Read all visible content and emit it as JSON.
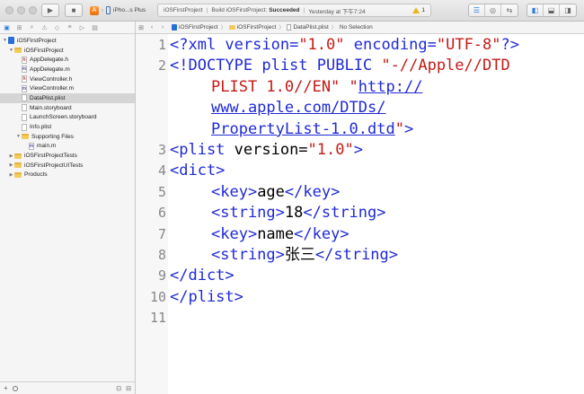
{
  "toolbar": {
    "scheme_device": "iPho...s Plus",
    "activity": {
      "project": "iOSFirstProject",
      "status_prefix": "Build iOSFirstProject:",
      "status_result": "Succeeded",
      "time": "Yesterday at 下午7:24",
      "warning_count": "1"
    }
  },
  "navigator": {
    "items": [
      {
        "label": "iOSFirstProject",
        "type": "project",
        "level": 0,
        "disclosure": "▼"
      },
      {
        "label": "iOSFirstProject",
        "type": "folder",
        "level": 1,
        "disclosure": "▼"
      },
      {
        "label": "AppDelegate.h",
        "type": "h",
        "level": 2
      },
      {
        "label": "AppDelegate.m",
        "type": "m",
        "level": 2
      },
      {
        "label": "ViewController.h",
        "type": "h",
        "level": 2
      },
      {
        "label": "ViewController.m",
        "type": "m",
        "level": 2
      },
      {
        "label": "DataPlist.plist",
        "type": "plist",
        "level": 2,
        "selected": true
      },
      {
        "label": "Main.storyboard",
        "type": "sb",
        "level": 2
      },
      {
        "label": "LaunchScreen.storyboard",
        "type": "sb",
        "level": 2
      },
      {
        "label": "Info.plist",
        "type": "plist",
        "level": 2
      },
      {
        "label": "Supporting Files",
        "type": "folder",
        "level": 2,
        "disclosure": "▼"
      },
      {
        "label": "main.m",
        "type": "m",
        "level": 3
      },
      {
        "label": "iOSFirstProjectTests",
        "type": "folder",
        "level": 1,
        "disclosure": "▶"
      },
      {
        "label": "iOSFirstProjectUITests",
        "type": "folder",
        "level": 1,
        "disclosure": "▶"
      },
      {
        "label": "Products",
        "type": "folder",
        "level": 1,
        "disclosure": "▶"
      }
    ]
  },
  "jumpbar": {
    "crumbs": [
      "iOSFirstProject",
      "iOSFirstProject",
      "DataPlist.plist",
      "No Selection"
    ]
  },
  "editor": {
    "line_numbers": [
      "1",
      "2",
      "3",
      "4",
      "5",
      "6",
      "7",
      "8",
      "9",
      "10",
      "11"
    ],
    "line1": {
      "open": "<?xml ",
      "attr1": "version=",
      "val1": "\"1.0\"",
      "attr2": " encoding=",
      "val2": "\"UTF-8\"",
      "close": "?>"
    },
    "line2": {
      "open": "<!DOCTYPE plist PUBLIC ",
      "str1": "\"-//Apple//DTD",
      "str1b": "PLIST 1.0//EN\"",
      "space": " ",
      "q_open": "\"",
      "url_a": "http://",
      "url_b": "www.apple.com/DTDs/",
      "url_c": "PropertyList-1.0.dtd",
      "q_close": "\"",
      "close": ">"
    },
    "line3": {
      "open": "<plist ",
      "attr": "version=",
      "val": "\"1.0\"",
      "close": ">"
    },
    "line4": "<dict>",
    "line5": {
      "open": "<key>",
      "text": "age",
      "close": "</key>"
    },
    "line6": {
      "open": "<string>",
      "text": "18",
      "close": "</string>"
    },
    "line7": {
      "open": "<key>",
      "text": "name",
      "close": "</key>"
    },
    "line8": {
      "open": "<string>",
      "text": "张三",
      "close": "</string>"
    },
    "line9": "</dict>",
    "line10": "</plist>"
  }
}
